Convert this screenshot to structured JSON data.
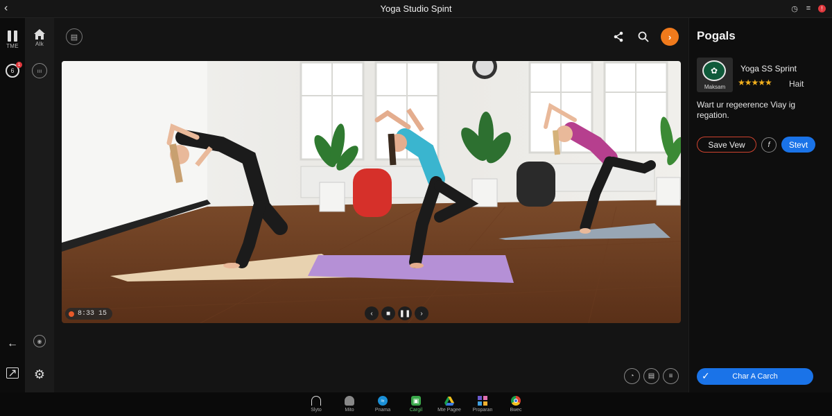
{
  "window": {
    "title": "Yoga Studio Spint"
  },
  "rail_left": {
    "items": [
      {
        "label": "TME",
        "icon": "pause-icon"
      },
      {
        "label": "",
        "icon": "timer-icon",
        "badge": "1"
      }
    ]
  },
  "rail_second": {
    "items": [
      {
        "label": "Alk",
        "icon": "home-icon"
      }
    ]
  },
  "player": {
    "timestamp": "8:33 15"
  },
  "panel": {
    "title": "Pogals",
    "item": {
      "name": "Yoga SS Sprint",
      "thumb_caption": "Maksam",
      "stars": "★★★★★",
      "rating_text": "Hait"
    },
    "description": "Wart ur regeerence Viay ig regation.",
    "save_label": "Save Vew",
    "f_label": "f",
    "start_label": "Stevt",
    "chat_label": "Char A Carch"
  },
  "taskbar": {
    "items": [
      {
        "label": "Slyto",
        "icon": "headphones-icon",
        "color": "#1a1a1a"
      },
      {
        "label": "Mito",
        "icon": "person-icon",
        "color": "#888888"
      },
      {
        "label": "Pnama",
        "icon": "wave-icon",
        "color": "#1a8fd6"
      },
      {
        "label": "Cargil",
        "icon": "cart-icon",
        "color": "#3aa84a"
      },
      {
        "label": "Mte Pagee",
        "icon": "drive-icon",
        "color": "#f2c01e"
      },
      {
        "label": "Proparan",
        "icon": "grid-icon",
        "color": "#6a5acd"
      },
      {
        "label": "Bwec",
        "icon": "chrome-icon",
        "color": "#e04030"
      }
    ]
  },
  "colors": {
    "accent": "#1a73e8",
    "orange": "#f07a1c",
    "save_border": "#d0432f",
    "stars": "#f2b01e"
  }
}
